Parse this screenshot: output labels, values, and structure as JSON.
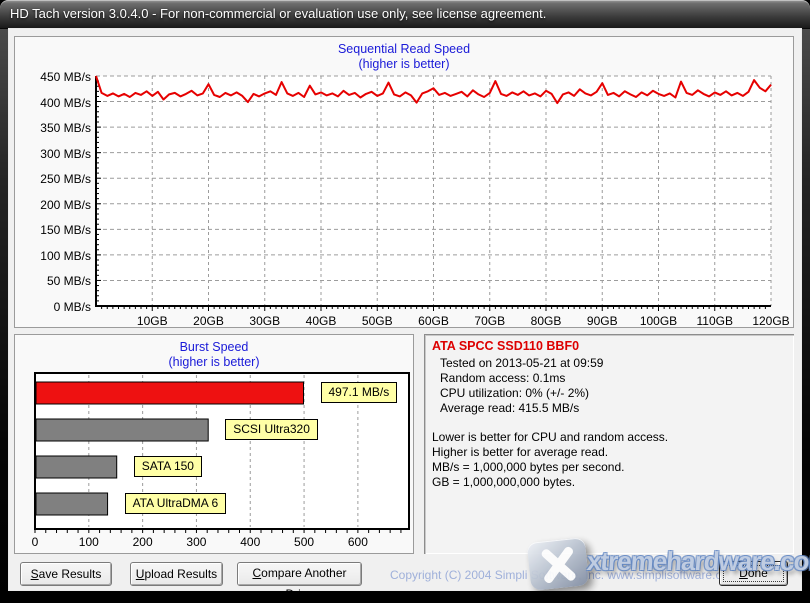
{
  "window": {
    "title": "HD Tach version 3.0.4.0  - For non-commercial or evaluation use only, see license agreement."
  },
  "buttons": {
    "save": "Save Results",
    "upload": "Upload Results",
    "compare": "Compare Another Drive",
    "done": "Done"
  },
  "footer": {
    "copyright": "Copyright (C) 2004 Simpli Software, Inc.  www.simplisoftware.com"
  },
  "watermark": {
    "text": "xtremehardware.com"
  },
  "info": {
    "drive": "ATA SPCC SSD110 BBF0",
    "drive_color": "#dd0000",
    "stats": [
      "Tested on 2013-05-21 at 09:59",
      "Random access: 0.1ms",
      "CPU utilization: 0% (+/- 2%)",
      "Average read: 415.5 MB/s"
    ],
    "notes": [
      "Lower is better for CPU and random access.",
      "Higher is better for average read.",
      "MB/s = 1,000,000 bytes per second.",
      "GB = 1,000,000,000 bytes."
    ]
  },
  "colors": {
    "chart_title_blue": "#1a1ad8",
    "line_red": "#e60000",
    "bar_red": "#ee1111",
    "bar_gray": "#808080",
    "label_yellow": "#ffffa6",
    "grid_gray": "#9c9c9c",
    "copyright_blue": "#9fb0da"
  },
  "chart_data": [
    {
      "type": "line",
      "title": "Sequential Read Speed",
      "subtitle": "(higher is better)",
      "line_color": "#e60000",
      "grid": "dashed",
      "xlim": [
        0,
        120
      ],
      "ylim": [
        0,
        450
      ],
      "x_step_gb": 1,
      "y_ticks": [
        {
          "value": 450,
          "label": "450 MB/s"
        },
        {
          "value": 400,
          "label": "400 MB/s"
        },
        {
          "value": 350,
          "label": "350 MB/s"
        },
        {
          "value": 300,
          "label": "300 MB/s"
        },
        {
          "value": 250,
          "label": "250 MB/s"
        },
        {
          "value": 200,
          "label": "200 MB/s"
        },
        {
          "value": 150,
          "label": "150 MB/s"
        },
        {
          "value": 100,
          "label": "100 MB/s"
        },
        {
          "value": 50,
          "label": "50 MB/s"
        },
        {
          "value": 0,
          "label": "0 MB/s"
        }
      ],
      "x_ticks": [
        {
          "value": 10,
          "label": "10GB"
        },
        {
          "value": 20,
          "label": "20GB"
        },
        {
          "value": 30,
          "label": "30GB"
        },
        {
          "value": 40,
          "label": "40GB"
        },
        {
          "value": 50,
          "label": "50GB"
        },
        {
          "value": 60,
          "label": "60GB"
        },
        {
          "value": 70,
          "label": "70GB"
        },
        {
          "value": 80,
          "label": "80GB"
        },
        {
          "value": 90,
          "label": "90GB"
        },
        {
          "value": 100,
          "label": "100GB"
        },
        {
          "value": 110,
          "label": "110GB"
        },
        {
          "value": 120,
          "label": "120GB"
        }
      ],
      "values": [
        450,
        417,
        411,
        416,
        410,
        415,
        409,
        417,
        413,
        420,
        411,
        419,
        404,
        414,
        417,
        410,
        415,
        421,
        412,
        416,
        434,
        413,
        409,
        417,
        412,
        418,
        411,
        399,
        415,
        410,
        416,
        420,
        413,
        438,
        416,
        411,
        417,
        409,
        431,
        414,
        418,
        412,
        416,
        410,
        421,
        413,
        417,
        408,
        415,
        419,
        411,
        416,
        437,
        414,
        410,
        418,
        412,
        398,
        416,
        420,
        426,
        413,
        417,
        411,
        415,
        419,
        410,
        422,
        414,
        409,
        417,
        440,
        415,
        411,
        418,
        413,
        420,
        412,
        416,
        410,
        421,
        415,
        397,
        414,
        418,
        411,
        424,
        416,
        412,
        419,
        436,
        413,
        417,
        410,
        420,
        414,
        409,
        418,
        412,
        421,
        415,
        411,
        416,
        408,
        439,
        417,
        413,
        422,
        415,
        410,
        418,
        413,
        420,
        412,
        417,
        411,
        419,
        442,
        427,
        420,
        433
      ]
    },
    {
      "type": "bar",
      "title": "Burst Speed",
      "subtitle": "(higher is better)",
      "orientation": "horizontal",
      "xlim": [
        0,
        695
      ],
      "x_ticks": [
        {
          "value": 0,
          "label": "0"
        },
        {
          "value": 100,
          "label": "100"
        },
        {
          "value": 200,
          "label": "200"
        },
        {
          "value": 300,
          "label": "300"
        },
        {
          "value": 400,
          "label": "400"
        },
        {
          "value": 500,
          "label": "500"
        },
        {
          "value": 600,
          "label": "600"
        }
      ],
      "bars": [
        {
          "label": "497.1 MB/s",
          "value": 497.1,
          "color": "#ee1111"
        },
        {
          "label": "SCSI Ultra320",
          "value": 320,
          "color": "#808080"
        },
        {
          "label": "SATA 150",
          "value": 150,
          "color": "#808080"
        },
        {
          "label": "ATA UltraDMA 6",
          "value": 133,
          "color": "#808080"
        }
      ]
    }
  ]
}
